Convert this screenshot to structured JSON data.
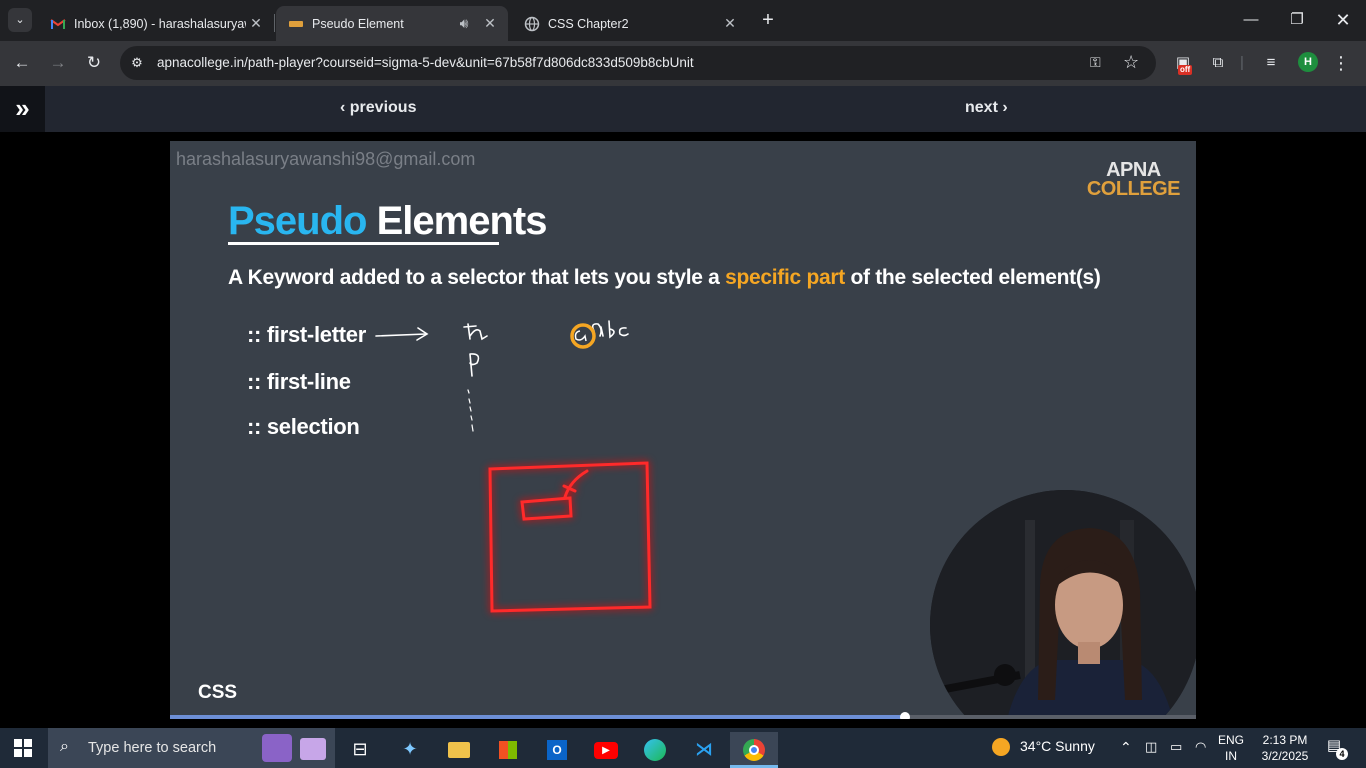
{
  "browser": {
    "tabs": [
      {
        "title": "Inbox (1,890) - harashalasuryaw",
        "icon": "gmail-icon",
        "active": false
      },
      {
        "title": "Pseudo Element",
        "icon": "apnacollege-icon",
        "active": true,
        "audio": true
      },
      {
        "title": "CSS Chapter2",
        "icon": "globe-icon",
        "active": false
      }
    ],
    "url": "apnacollege.in/path-player?courseid=sigma-5-dev&unit=67b58f7d806dc833d509b8cbUnit",
    "profile_initial": "H",
    "extension_badge": "off"
  },
  "player": {
    "previous_label": "‹ previous",
    "next_label": "next ›",
    "progress": 0.716
  },
  "slide": {
    "watermark": "harashalasuryawanshi98@gmail.com",
    "brand_line1": "APNA",
    "brand_line2": "COLLEGE",
    "title_part1": "Pseudo",
    "title_part2": " Elements",
    "subtitle_pre": "A Keyword added to a selector that lets you style a ",
    "subtitle_highlight": "specific part",
    "subtitle_post": " of the selected element(s)",
    "items": [
      ":: first-letter",
      ":: first-line",
      ":: selection"
    ],
    "footer": "CSS",
    "colors": {
      "title_accent": "#29b6f0",
      "highlight": "#f5a623",
      "annotation": "#ff1a1a"
    }
  },
  "taskbar": {
    "search_placeholder": "Type here to search",
    "weather": "34°C  Sunny",
    "lang_top": "ENG",
    "lang_bottom": "IN",
    "time": "2:13 PM",
    "date": "3/2/2025",
    "notification_count": "4"
  }
}
